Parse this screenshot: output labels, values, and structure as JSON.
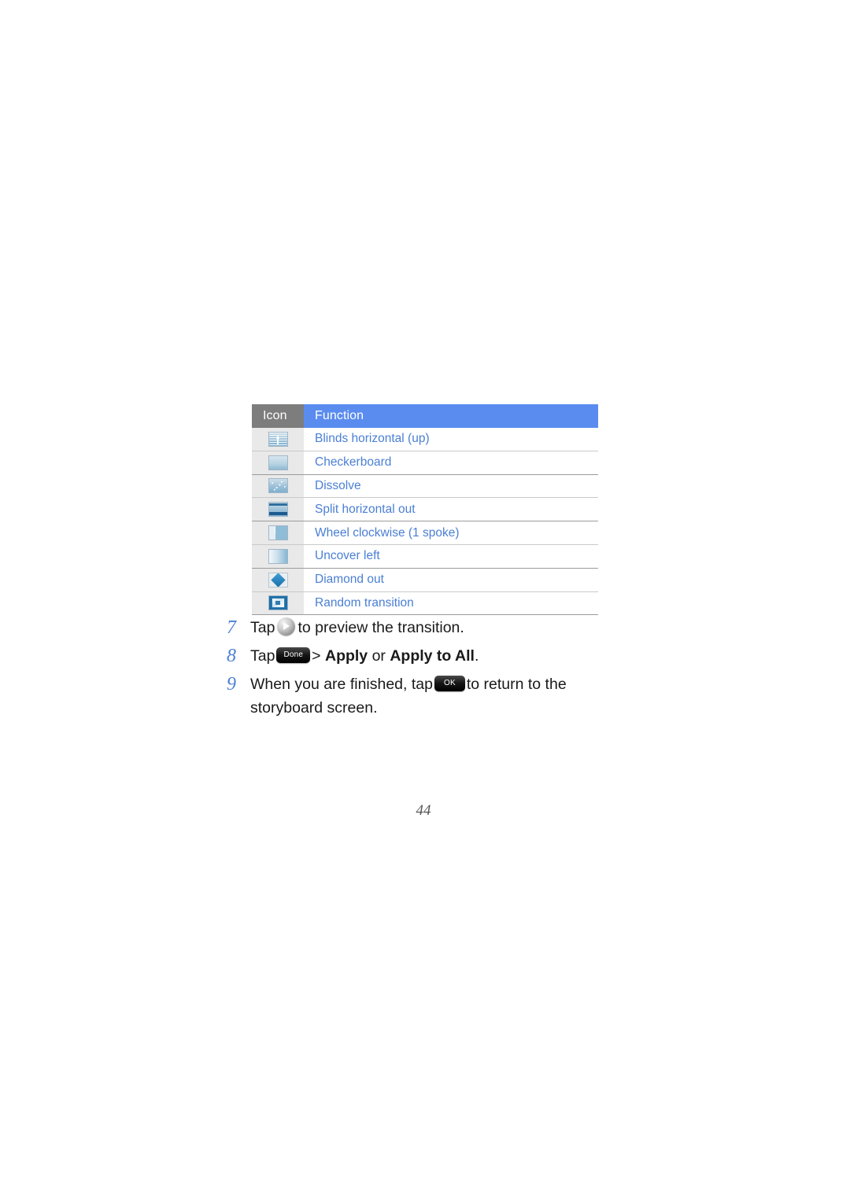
{
  "page": {
    "number": "44",
    "background_color": "#ffffff"
  },
  "table": {
    "header": {
      "icon_label": "Icon",
      "function_label": "Function",
      "icon_bg_color": "#7d7d7d",
      "function_bg_color": "#5a8cf0",
      "header_text_color": "#ffffff"
    },
    "row_text_color": "#4a7fd4",
    "icon_cell_bg_color": "#e9e9e9",
    "rows": [
      {
        "icon": "blinds-horizontal-up-thumbnail",
        "function": "Blinds horizontal (up)"
      },
      {
        "icon": "checkerboard-thumbnail",
        "function": "Checkerboard"
      },
      {
        "icon": "dissolve-thumbnail",
        "function": "Dissolve"
      },
      {
        "icon": "split-horizontal-out-thumbnail",
        "function": "Split horizontal out"
      },
      {
        "icon": "wheel-clockwise-thumbnail",
        "function": "Wheel clockwise (1 spoke)"
      },
      {
        "icon": "uncover-left-thumbnail",
        "function": "Uncover left"
      },
      {
        "icon": "diamond-out-thumbnail",
        "function": "Diamond out"
      },
      {
        "icon": "random-transition-thumbnail",
        "function": "Random transition"
      }
    ]
  },
  "steps": [
    {
      "number": "7",
      "text_before": "Tap",
      "icon": "play-icon",
      "text_after": "to preview the transition."
    },
    {
      "number": "8",
      "text_before": "Tap",
      "button_label": "Done",
      "separator": ">",
      "option_one": "Apply",
      "conjunction": "or",
      "option_two": "Apply to All",
      "terminator": "."
    },
    {
      "number": "9",
      "text_before": "When you are finished, tap",
      "button_label": "OK",
      "text_after": "to return to the storyboard screen."
    }
  ],
  "step_number_color": "#4a7fd4"
}
